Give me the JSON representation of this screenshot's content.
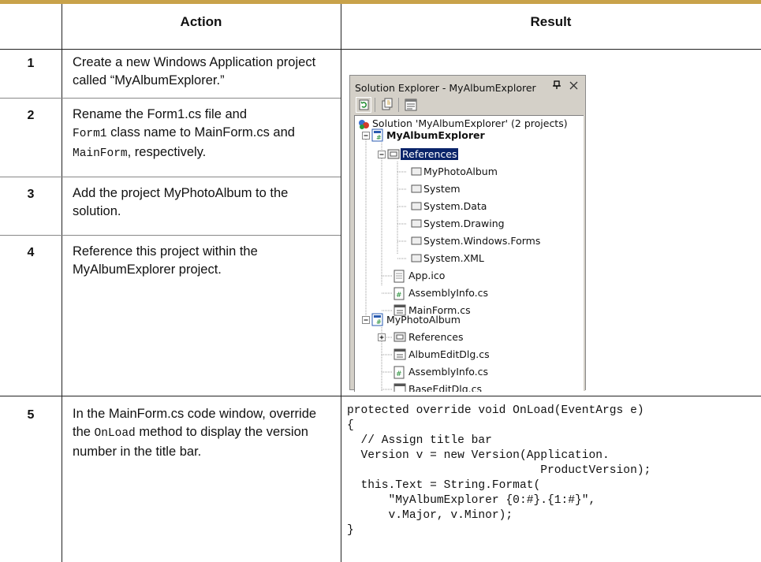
{
  "table": {
    "headers": {
      "action": "Action",
      "result": "Result"
    },
    "steps": [
      {
        "num": "1",
        "text": "Create a new Windows Application project called “MyAlbumExplorer.”"
      },
      {
        "num": "2",
        "text_a": "Rename the Form1.cs file and",
        "code_a": "Form1",
        "text_b": " class name to MainForm.cs and ",
        "code_b": "MainForm",
        "text_c": ", respectively."
      },
      {
        "num": "3",
        "text": "Add the project MyPhotoAlbum to the solution."
      },
      {
        "num": "4",
        "text": "Reference this project within the MyAlbumExplorer project."
      },
      {
        "num": "5",
        "text_a": "In the MainForm.cs code window, override the ",
        "code_a": "OnLoad",
        "text_b": " method to display the version number in the title bar."
      }
    ]
  },
  "solution_explorer": {
    "title": "Solution Explorer - MyAlbumExplorer",
    "pin_icon": "pin-icon",
    "close_icon": "close-icon",
    "toolbar": [
      "refresh-icon",
      "show-all-files-icon",
      "properties-icon"
    ],
    "tree": {
      "solution": "Solution 'MyAlbumExplorer' (2 projects)",
      "project1": "MyAlbumExplorer",
      "references": "References",
      "ref_items": [
        "MyPhotoAlbum",
        "System",
        "System.Data",
        "System.Drawing",
        "System.Windows.Forms",
        "System.XML"
      ],
      "files1": [
        "App.ico",
        "AssemblyInfo.cs",
        "MainForm.cs"
      ],
      "project2": "MyPhotoAlbum",
      "references2": "References",
      "files2": [
        "AlbumEditDlg.cs",
        "AssemblyInfo.cs",
        "BaseEditDlg.cs"
      ]
    },
    "colors": {
      "selection": "#0a246a",
      "panel": "#d4d0c8"
    }
  },
  "code": "protected override void OnLoad(EventArgs e)\n{\n  // Assign title bar\n  Version v = new Version(Application.\n                            ProductVersion);\n  this.Text = String.Format(\n      \"MyAlbumExplorer {0:#}.{1:#}\",\n      v.Major, v.Minor);\n}",
  "colors": {
    "top_rule": "#c8a24a"
  }
}
